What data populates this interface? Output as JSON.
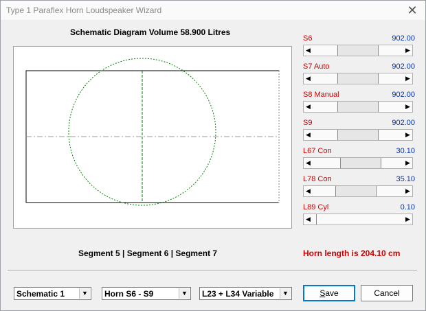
{
  "window": {
    "title": "Type 1 Paraflex Horn Loudspeaker Wizard",
    "close_glyph": "✕"
  },
  "diagram": {
    "title": "Schematic Diagram   Volume 58.900 Litres"
  },
  "params": [
    {
      "label": "S6",
      "value": "902.00",
      "thumb": 0.5
    },
    {
      "label": "S7  Auto",
      "value": "902.00",
      "thumb": 0.5
    },
    {
      "label": "S8  Manual",
      "value": "902.00",
      "thumb": 0.5
    },
    {
      "label": "S9",
      "value": "902.00",
      "thumb": 0.5
    },
    {
      "label": "L67  Con",
      "value": "30.10",
      "thumb": 0.55
    },
    {
      "label": "L78  Con",
      "value": "35.10",
      "thumb": 0.46
    },
    {
      "label": "L89  Cyl",
      "value": "0.10",
      "thumb": 0.0
    }
  ],
  "status": {
    "segments": "Segment 5  |  Segment 6  |  Segment 7",
    "horn_length": "Horn length is 204.10 cm"
  },
  "controls": {
    "combo1": "Schematic 1",
    "combo2": "Horn S6 - S9",
    "combo3": "L23 + L34 Variable",
    "save_first": "S",
    "save_rest": "ave",
    "cancel": "Cancel",
    "combo_arrow": "▼"
  },
  "arrows": {
    "left": "◀",
    "right": "▶"
  },
  "colors": {
    "label_red": "#cc0000",
    "value_blue": "#0033aa",
    "circle_green": "#008000"
  }
}
